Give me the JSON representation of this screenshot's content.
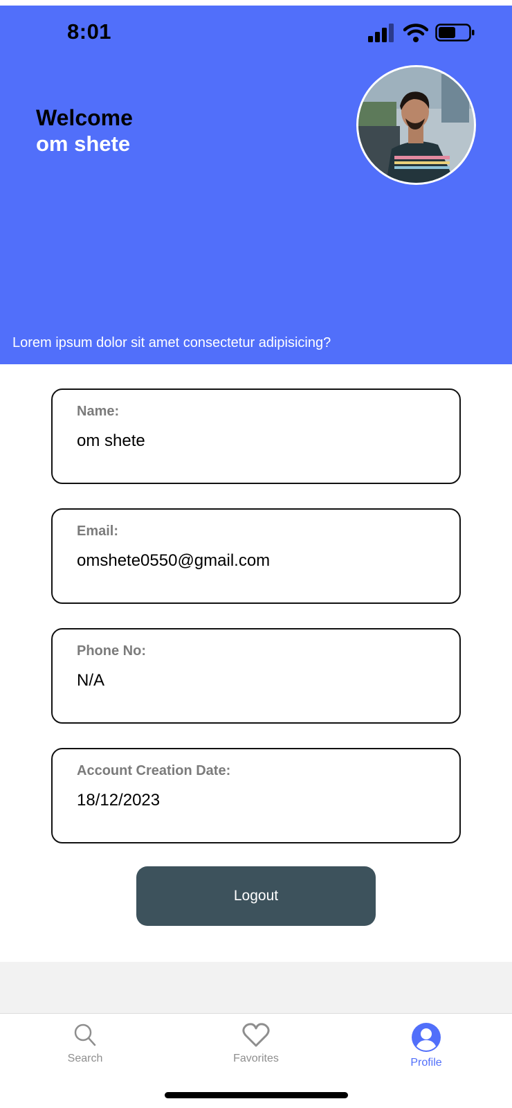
{
  "status_bar": {
    "time": "8:01"
  },
  "header": {
    "welcome": "Welcome",
    "user_name": "om shete",
    "tagline": "Lorem ipsum dolor sit amet consectetur adipisicing?"
  },
  "fields": [
    {
      "label": "Name:",
      "value": "om shete"
    },
    {
      "label": "Email:",
      "value": "omshete0550@gmail.com"
    },
    {
      "label": "Phone No:",
      "value": "N/A"
    },
    {
      "label": "Account Creation Date:",
      "value": "18/12/2023"
    }
  ],
  "logout_label": "Logout",
  "tabs": [
    {
      "label": "Search",
      "icon": "search-icon",
      "active": false
    },
    {
      "label": "Favorites",
      "icon": "heart-icon",
      "active": false
    },
    {
      "label": "Profile",
      "icon": "profile-icon",
      "active": true
    }
  ],
  "colors": {
    "header_blue": "#516ffa",
    "logout_button": "#3d525c",
    "active_tab": "#516ffa",
    "inactive_tab": "#8e8e8e"
  }
}
